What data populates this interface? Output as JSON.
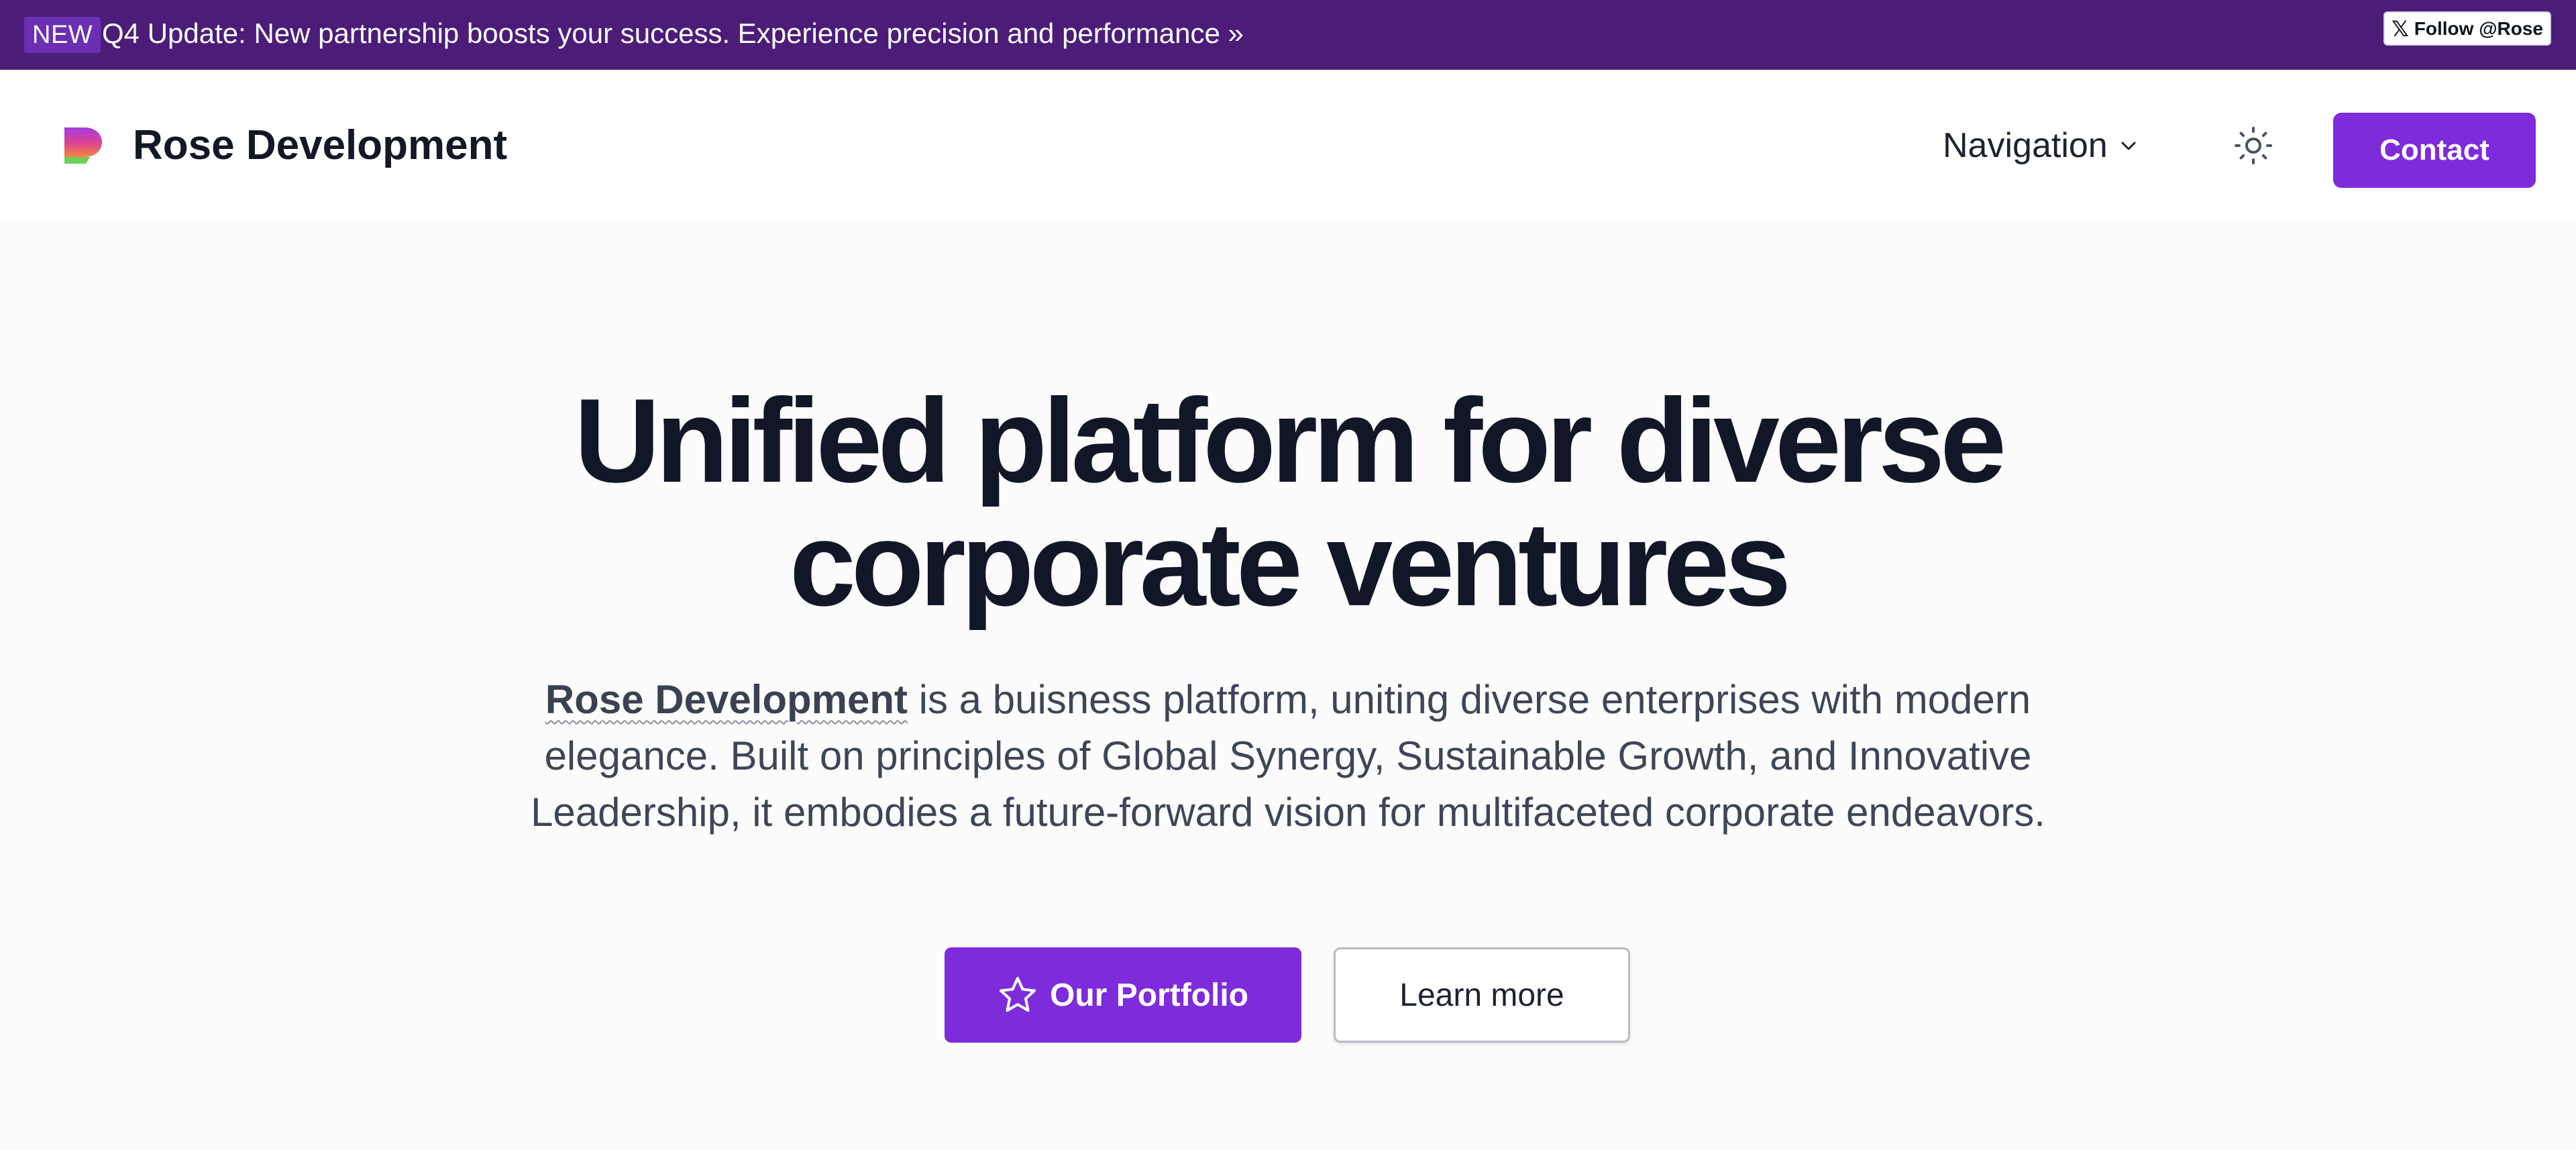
{
  "announcement": {
    "badge": "NEW",
    "text": "Q4 Update: New partnership boosts your success. Experience precision and performance »",
    "follow_label": "Follow @Rose",
    "follow_icon": "x-logo-icon"
  },
  "header": {
    "brand": "Rose Development",
    "nav_label": "Navigation",
    "theme_icon": "sun-icon",
    "contact_label": "Contact"
  },
  "hero": {
    "title_line1": "Unified platform for diverse",
    "title_line2": "corporate ventures",
    "desc_brand": "Rose Development",
    "desc_rest": " is a buisness platform, uniting diverse enterprises with modern elegance. Built on principles of Global Synergy, Sustainable Growth, and Innovative Leadership, it embodies a future-forward vision for multifaceted corporate endeavors.",
    "primary_button": "Our Portfolio",
    "secondary_button": "Learn more"
  },
  "colors": {
    "announcement_bg": "#4b1d78",
    "accent": "#7e2bdc",
    "text_dark": "#111726"
  }
}
